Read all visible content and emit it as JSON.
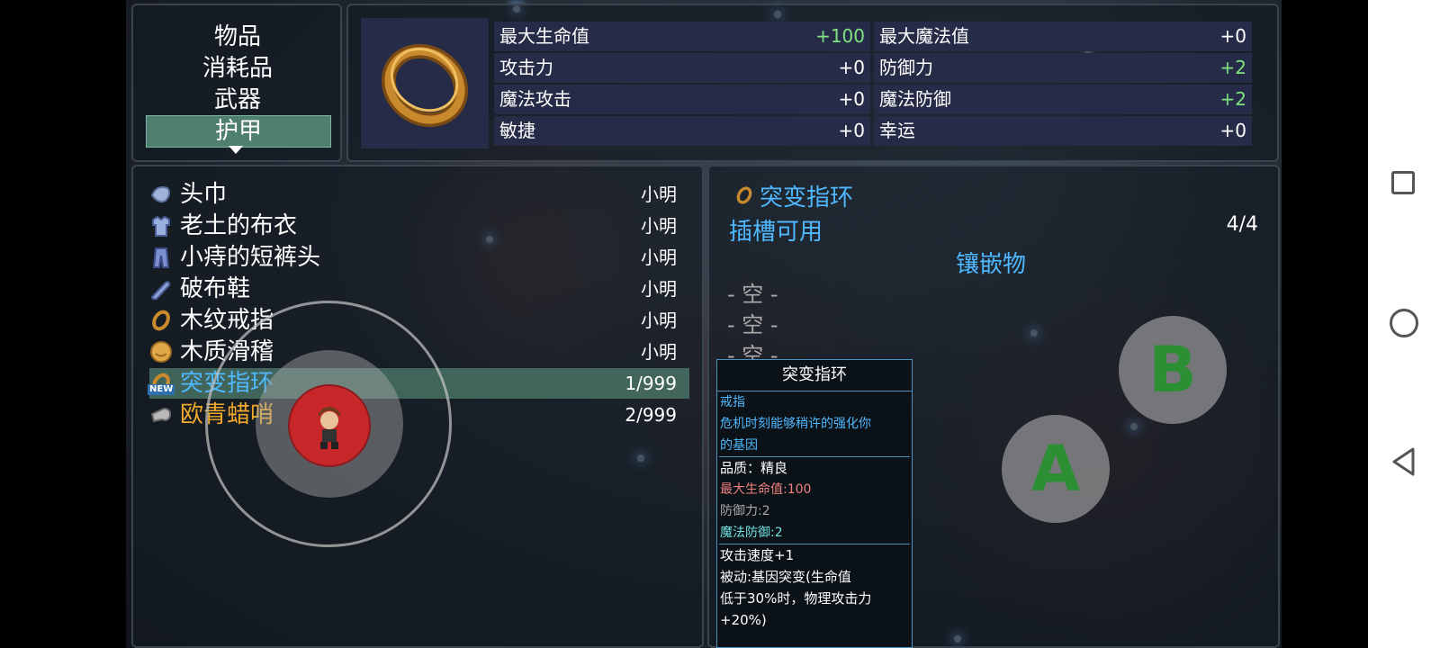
{
  "categories": {
    "items": [
      "物品",
      "消耗品",
      "武器",
      "护甲"
    ],
    "selected": "护甲"
  },
  "stats": {
    "rows": [
      {
        "label": "最大生命值",
        "value": "+100",
        "label2": "最大魔法值",
        "value2": "+0"
      },
      {
        "label": "攻击力",
        "value": "+0",
        "label2": "防御力",
        "value2": "+2"
      },
      {
        "label": "魔法攻击",
        "value": "+0",
        "label2": "魔法防御",
        "value2": "+2"
      },
      {
        "label": "敏捷",
        "value": "+0",
        "label2": "幸运",
        "value2": "+0"
      }
    ]
  },
  "inventory": {
    "items": [
      {
        "name": "头巾",
        "owner": "小明",
        "icon": "bandana-icon"
      },
      {
        "name": "老土的布衣",
        "owner": "小明",
        "icon": "cloth-shirt-icon"
      },
      {
        "name": "小痔的短裤头",
        "owner": "小明",
        "icon": "shorts-icon"
      },
      {
        "name": "破布鞋",
        "owner": "小明",
        "icon": "shoe-icon"
      },
      {
        "name": "木纹戒指",
        "owner": "小明",
        "icon": "wood-ring-icon"
      },
      {
        "name": "木质滑稽",
        "owner": "小明",
        "icon": "wood-face-icon"
      },
      {
        "name": "突变指环",
        "owner": "1/999",
        "icon": "mutation-ring-icon",
        "badge": "NEW"
      },
      {
        "name": "欧青蜡哨",
        "owner": "2/999",
        "icon": "whistle-icon"
      }
    ]
  },
  "detail": {
    "title": "突变指环",
    "slot_label": "插槽可用",
    "slot_count": "4/4",
    "inlay_label": "镶嵌物",
    "empty_slot": "- 空 -"
  },
  "tooltip": {
    "title": "突变指环",
    "type": "戒指",
    "desc1": "危机时刻能够稍许的强化你",
    "desc2": "的基因",
    "quality": "品质：精良",
    "hp": "最大生命值:100",
    "def": "防御力:2",
    "mdef": "魔法防御:2",
    "speed": "攻击速度+1",
    "passive1": "被动:基因突变(生命值",
    "passive2": "低于30%时，物理攻击力",
    "passive3": "+20%)"
  },
  "controls": {
    "a_label": "A",
    "b_label": "B"
  },
  "colors": {
    "accent": "#4fb8ff",
    "positive": "#7fe27f",
    "gold_item": "#f0a92a",
    "selected_row": "#4f7f6f"
  }
}
